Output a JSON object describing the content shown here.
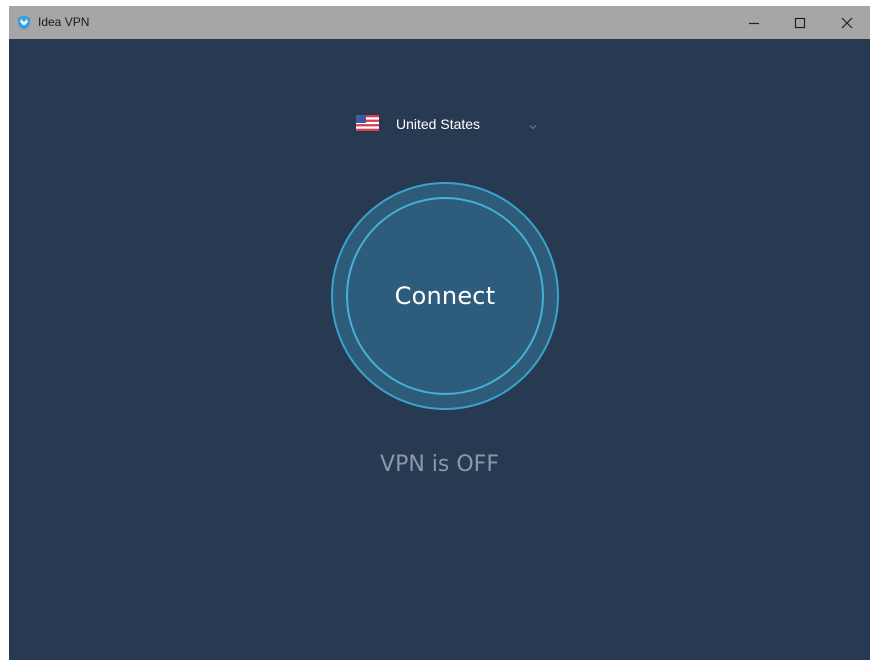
{
  "window": {
    "title": "Idea VPN",
    "app_icon": "shield-icon",
    "controls": {
      "minimize_icon": "minimize-icon",
      "maximize_icon": "maximize-icon",
      "close_icon": "close-icon"
    }
  },
  "location": {
    "selected_country": "United States",
    "flag_icon": "us-flag-icon",
    "dropdown_icon": "chevron-down-icon"
  },
  "connect_button": {
    "label": "Connect"
  },
  "status": {
    "text": "VPN is OFF"
  },
  "colors": {
    "background": "#273a52",
    "titlebar": "#a6a6a6",
    "accent_ring": "#3aa3c9",
    "button_fill": "#2e5b7a",
    "status_text": "#8c98a6"
  }
}
